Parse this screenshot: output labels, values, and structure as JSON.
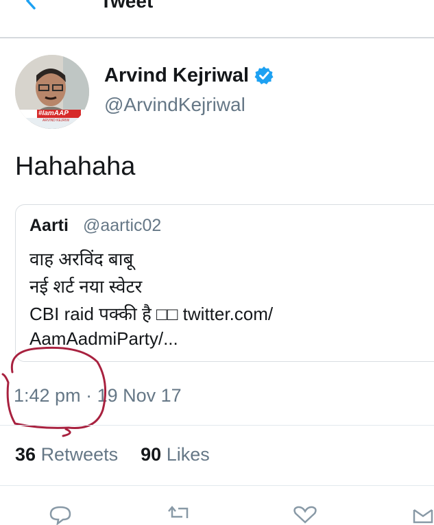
{
  "header": {
    "title": "Tweet",
    "back_icon": "chevron-left-icon"
  },
  "author": {
    "name": "Arvind Kejriwal",
    "handle": "@ArvindKejriwal",
    "verified": true,
    "avatar_badge": "#IamAAP",
    "avatar_small_text": "ARVIND KEJRIW"
  },
  "tweet": {
    "text": "Hahahaha"
  },
  "quoted": {
    "name": "Aarti",
    "handle": "@aartic02",
    "lines": [
      "वाह अरविंद बाबू",
      "नई शर्ट नया स्वेटर",
      "CBI raid पक्की है □□ twitter.com/",
      "AamAadmiParty/..."
    ]
  },
  "meta": {
    "time": "1:42 pm",
    "separator": "·",
    "date": "19 Nov 17"
  },
  "stats": {
    "retweets_count": "36",
    "retweets_label": "Retweets",
    "likes_count": "90",
    "likes_label": "Likes"
  },
  "actions": [
    "reply-icon",
    "retweet-icon",
    "like-icon",
    "share-icon"
  ],
  "colors": {
    "accent": "#1da1f2",
    "secondary_text": "#657786",
    "annotation": "#a8213f"
  }
}
